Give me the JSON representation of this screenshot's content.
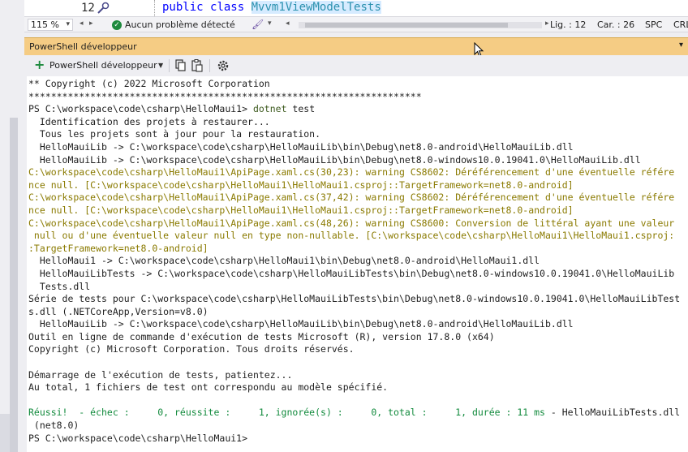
{
  "editor": {
    "line_number": "12",
    "code_keyword_public": "public",
    "code_keyword_class": "class",
    "code_class_name": "Mvvm1ViewModelTests",
    "quick_action_icon": "screwdriver-icon"
  },
  "editor_status": {
    "zoom": "115 %",
    "status_message": "Aucun problème détecté",
    "status_icon": "check-circle-icon",
    "line": "Lig. : 12",
    "column": "Car. : 26",
    "whitespace": "SPC",
    "line_ending": "CRLF"
  },
  "tool_window": {
    "title": "PowerShell développeur",
    "controls_icon": "dropdown-pin-icon",
    "toolbar": {
      "new_shell_label": "PowerShell développeur",
      "new_icon": "plus-icon",
      "copy_icon": "copy-icon",
      "paste_icon": "paste-icon",
      "settings_icon": "gear-icon"
    }
  },
  "terminal": {
    "lines": [
      {
        "type": "normal",
        "text": "** Copyright (c) 2022 Microsoft Corporation"
      },
      {
        "type": "normal",
        "text": "**********************************************************************"
      },
      {
        "type": "prompt",
        "prompt": "PS C:\\workspace\\code\\csharp\\HelloMaui1> ",
        "command": "dotnet",
        "args": " test"
      },
      {
        "type": "normal",
        "text": "  Identification des projets à restaurer..."
      },
      {
        "type": "normal",
        "text": "  Tous les projets sont à jour pour la restauration."
      },
      {
        "type": "normal",
        "text": "  HelloMauiLib -> C:\\workspace\\code\\csharp\\HelloMauiLib\\bin\\Debug\\net8.0-android\\HelloMauiLib.dll"
      },
      {
        "type": "normal",
        "text": "  HelloMauiLib -> C:\\workspace\\code\\csharp\\HelloMauiLib\\bin\\Debug\\net8.0-windows10.0.19041.0\\HelloMauiLib.dll"
      },
      {
        "type": "warning",
        "text": "C:\\workspace\\code\\csharp\\HelloMaui1\\ApiPage.xaml.cs(30,23): warning CS8602: Déréférencement d'une éventuelle référe"
      },
      {
        "type": "warning",
        "text": "nce null. [C:\\workspace\\code\\csharp\\HelloMaui1\\HelloMaui1.csproj::TargetFramework=net8.0-android]"
      },
      {
        "type": "warning",
        "text": "C:\\workspace\\code\\csharp\\HelloMaui1\\ApiPage.xaml.cs(37,42): warning CS8602: Déréférencement d'une éventuelle référe"
      },
      {
        "type": "warning",
        "text": "nce null. [C:\\workspace\\code\\csharp\\HelloMaui1\\HelloMaui1.csproj::TargetFramework=net8.0-android]"
      },
      {
        "type": "warning",
        "text": "C:\\workspace\\code\\csharp\\HelloMaui1\\ApiPage.xaml.cs(48,26): warning CS8600: Conversion de littéral ayant une valeur"
      },
      {
        "type": "warning",
        "text": " null ou d'une éventuelle valeur null en type non-nullable. [C:\\workspace\\code\\csharp\\HelloMaui1\\HelloMaui1.csproj:"
      },
      {
        "type": "warning",
        "text": ":TargetFramework=net8.0-android]"
      },
      {
        "type": "normal",
        "text": "  HelloMaui1 -> C:\\workspace\\code\\csharp\\HelloMaui1\\bin\\Debug\\net8.0-android\\HelloMaui1.dll"
      },
      {
        "type": "normal",
        "text": "  HelloMauiLibTests -> C:\\workspace\\code\\csharp\\HelloMauiLibTests\\bin\\Debug\\net8.0-windows10.0.19041.0\\HelloMauiLib"
      },
      {
        "type": "normal",
        "text": "  Tests.dll"
      },
      {
        "type": "normal",
        "text": "Série de tests pour C:\\workspace\\code\\csharp\\HelloMauiLibTests\\bin\\Debug\\net8.0-windows10.0.19041.0\\HelloMauiLibTest"
      },
      {
        "type": "normal",
        "text": "s.dll (.NETCoreApp,Version=v8.0)"
      },
      {
        "type": "normal",
        "text": "  HelloMauiLib -> C:\\workspace\\code\\csharp\\HelloMauiLib\\bin\\Debug\\net8.0-android\\HelloMauiLib.dll"
      },
      {
        "type": "normal",
        "text": "Outil en ligne de commande d'exécution de tests Microsoft (R), version 17.8.0 (x64)"
      },
      {
        "type": "normal",
        "text": "Copyright (c) Microsoft Corporation. Tous droits réservés."
      },
      {
        "type": "normal",
        "text": ""
      },
      {
        "type": "normal",
        "text": "Démarrage de l'exécution de tests, patientez..."
      },
      {
        "type": "normal",
        "text": "Au total, 1 fichiers de test ont correspondu au modèle spécifié."
      },
      {
        "type": "normal",
        "text": ""
      },
      {
        "type": "result",
        "pass": "Réussi!  - échec :     0, réussite :     1, ignorée(s) :     0, total :     1, durée : 11 ms",
        "rest": " - HelloMauiLibTests.dll"
      },
      {
        "type": "normal",
        "text": " (net8.0)"
      },
      {
        "type": "normal",
        "text": "PS C:\\workspace\\code\\csharp\\HelloMaui1>"
      }
    ]
  },
  "colors": {
    "tool_window_title_bg": "#f5cc84",
    "warning_text": "#8a7a00",
    "success_text": "#118a3c",
    "keyword": "#0000ff",
    "class_name": "#2b91af"
  }
}
